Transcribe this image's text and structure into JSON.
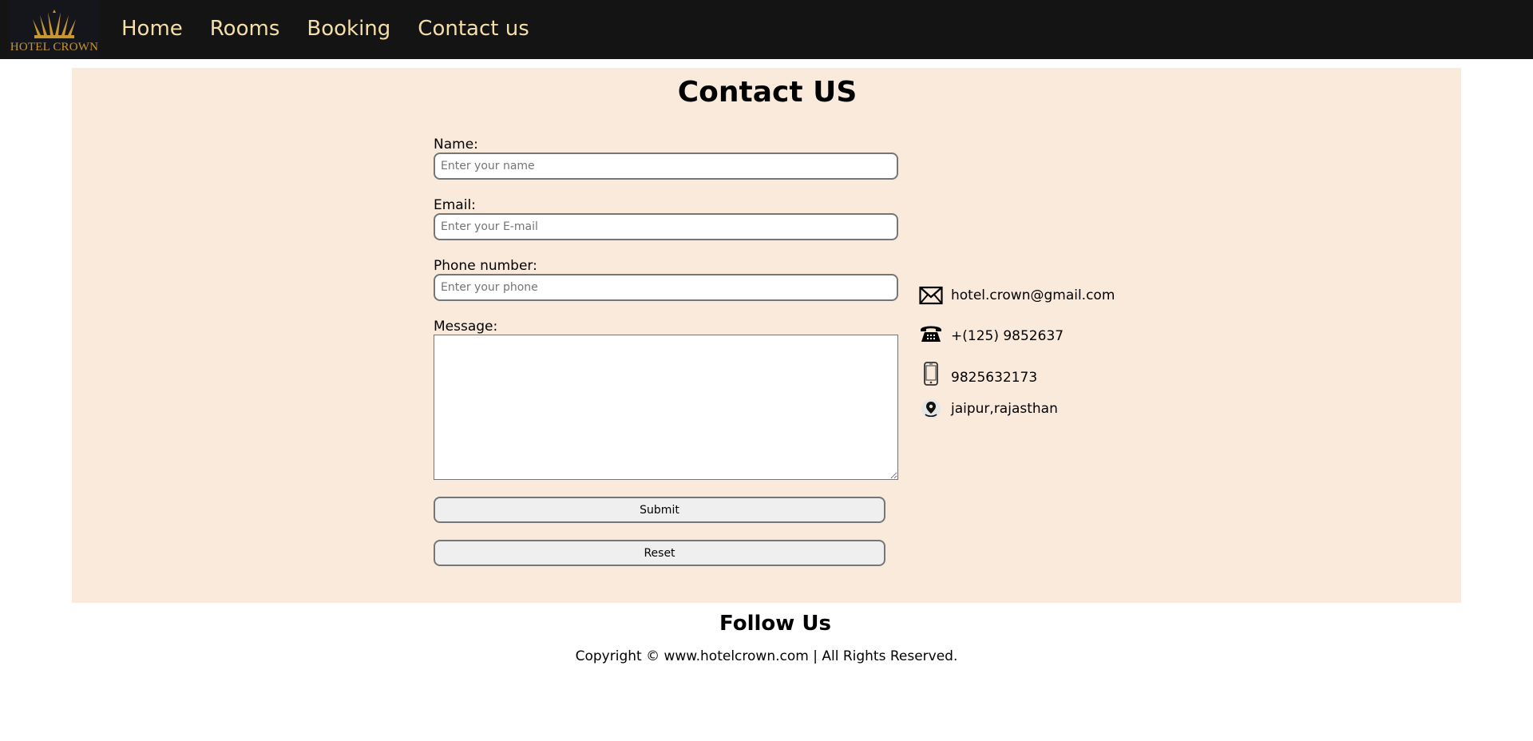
{
  "navbar": {
    "logo_text": "HOTEL CROWN",
    "links": [
      "Home",
      "Rooms",
      "Booking",
      "Contact us"
    ]
  },
  "contact": {
    "title": "Contact US",
    "form": {
      "name_label": "Name:",
      "name_placeholder": "Enter your name",
      "name_value": "",
      "email_label": "Email:",
      "email_placeholder": "Enter your E-mail",
      "email_value": "",
      "phone_label": "Phone number:",
      "phone_placeholder": "Enter your phone",
      "phone_value": "",
      "message_label": "Message:",
      "message_value": "",
      "submit_label": "Submit",
      "reset_label": "Reset"
    },
    "info": {
      "email": "hotel.crown@gmail.com",
      "landline": "+(125) 9852637",
      "mobile": "9825632173",
      "location": "jaipur,rajasthan"
    }
  },
  "footer": {
    "follow_title": "Follow Us",
    "copyright": "Copyright © www.hotelcrown.com | All Rights Reserved."
  },
  "colors": {
    "navbar_bg": "#141414",
    "nav_link": "#f5dfa8",
    "logo_gold": "#c8962e",
    "panel_bg": "#f9eadc"
  },
  "icons": {
    "logo": "crown-icon",
    "email": "envelope-icon",
    "landline": "telephone-icon",
    "mobile": "mobile-phone-icon",
    "location": "location-pin-icon"
  }
}
